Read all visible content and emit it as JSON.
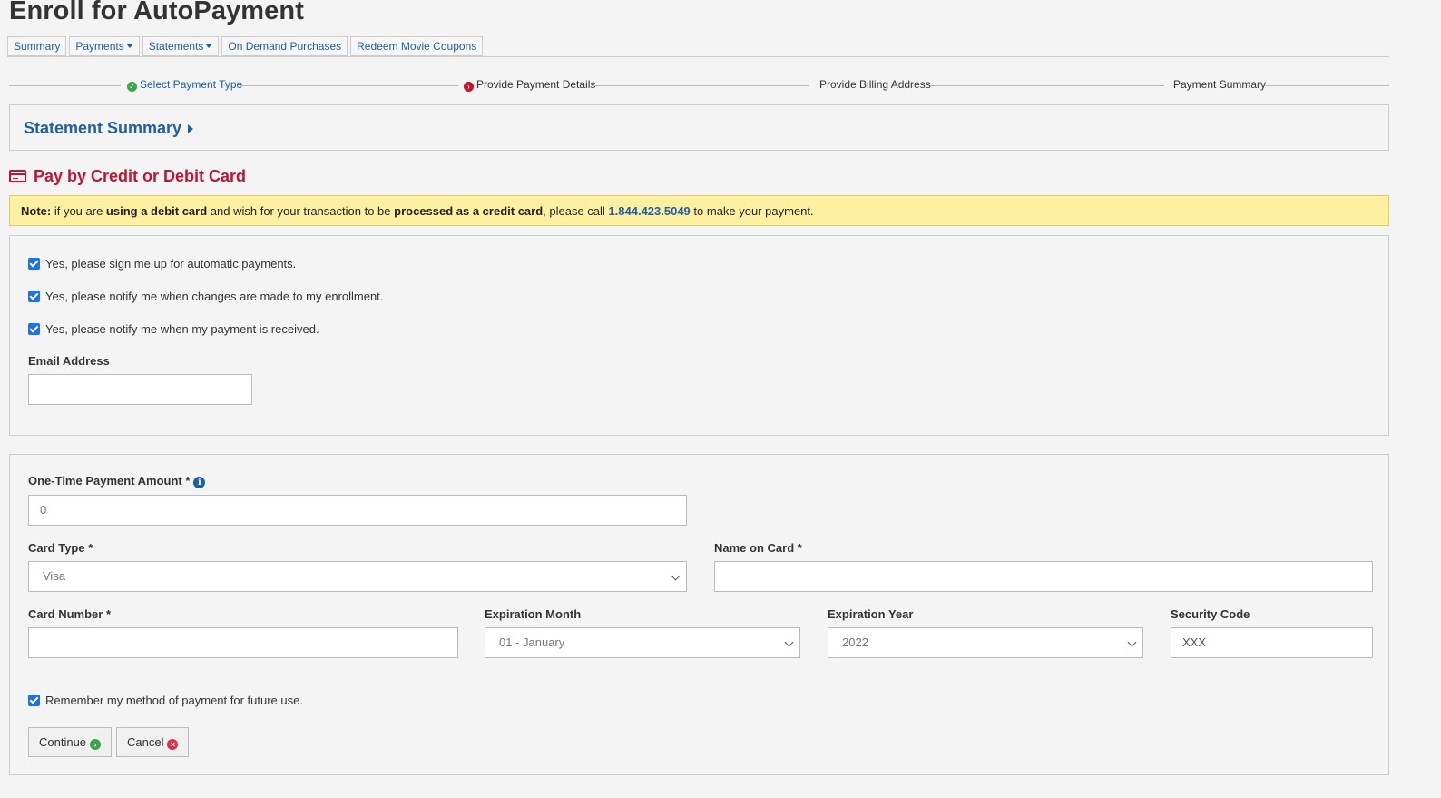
{
  "page_title": "Enroll for AutoPayment",
  "tabs": [
    {
      "label": "Summary"
    },
    {
      "label": "Payments"
    },
    {
      "label": "Statements"
    },
    {
      "label": "On Demand Purchases"
    },
    {
      "label": "Redeem Movie Coupons"
    }
  ],
  "steps": [
    {
      "label": "Select Payment Type",
      "status": "done"
    },
    {
      "label": "Provide Payment Details",
      "status": "current"
    },
    {
      "label": "Provide Billing Address",
      "status": "pending"
    },
    {
      "label": "Payment Summary",
      "status": "pending"
    }
  ],
  "statement_summary": "Statement Summary",
  "section_title": "Pay by Credit or Debit Card",
  "note": {
    "prefix": "Note:",
    "t1": " if you are ",
    "b1": "using a debit card",
    "t2": " and wish for your transaction to be ",
    "b2": "processed as a credit card",
    "t3": ", please call ",
    "phone": "1.844.423.5049",
    "t4": " to make your payment."
  },
  "enrollment": {
    "options": [
      {
        "label": "Yes, please sign me up for automatic payments.",
        "checked": true
      },
      {
        "label": "Yes, please notify me when changes are made to my enrollment.",
        "checked": true
      },
      {
        "label": "Yes, please notify me when my payment is received.",
        "checked": true
      }
    ],
    "email_label": "Email Address",
    "email_value": ""
  },
  "payment_form": {
    "amount_label": "One-Time Payment Amount *",
    "amount_placeholder": "0",
    "card_type_label": "Card Type *",
    "card_type_value": "Visa",
    "name_label": "Name on Card *",
    "card_number_label": "Card Number *",
    "exp_month_label": "Expiration Month",
    "exp_month_value": "01 - January",
    "exp_year_label": "Expiration Year",
    "exp_year_value": "2022",
    "security_label": "Security Code",
    "security_placeholder": "XXX",
    "remember_label": "Remember my method of payment for future use.",
    "remember_checked": true,
    "continue_label": "Continue",
    "cancel_label": "Cancel"
  },
  "colors": {
    "link": "#1f5fa6",
    "accent_red": "#c41230",
    "note_bg": "#fdf0a0",
    "success_green": "#3aa64b",
    "checkbox": "#1a73e8"
  }
}
